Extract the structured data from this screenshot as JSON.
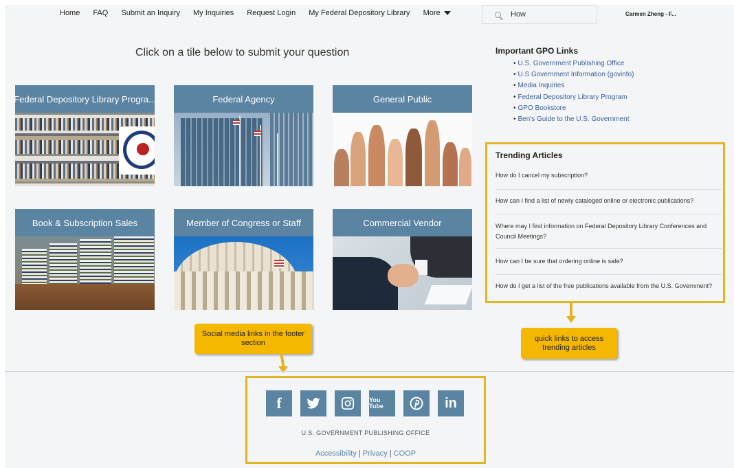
{
  "nav": {
    "items": [
      "Home",
      "FAQ",
      "Submit an Inquiry",
      "My Inquiries",
      "Request Login",
      "My Federal Depository Library"
    ],
    "more_label": "More"
  },
  "search": {
    "value": "How",
    "icon": "search-icon"
  },
  "user": {
    "name": "Carmen Zheng - F..."
  },
  "headline": "Click on a tile below to submit your question",
  "tiles": [
    {
      "label": "Federal Depository Library Progra..."
    },
    {
      "label": "Federal Agency"
    },
    {
      "label": "General Public"
    },
    {
      "label": "Book & Subscription Sales"
    },
    {
      "label": "Member of Congress or Staff"
    },
    {
      "label": "Commercial Vendor"
    }
  ],
  "gpo_links": {
    "title": "Important GPO Links",
    "items": [
      "U.S. Government Publishing Office",
      "U.S Government Information (govinfo)",
      "Media Inquiries",
      "Federal Depository Library Program",
      "GPO Bookstore",
      "Ben's Guide to the U.S. Government"
    ]
  },
  "trending": {
    "title": "Trending Articles",
    "articles": [
      "How do I cancel my subscription?",
      "How can I find a list of newly cataloged online or electronic publications?",
      "Where may I find information on Federal Depository Library Conferences and Council Meetings?",
      "How can I be sure that ordering online is safe?",
      "How do I get a list of the free publications available from the U.S. Government?"
    ]
  },
  "callouts": {
    "social": "Social media links in the footer section",
    "trending": "quick links to access trending articles"
  },
  "footer": {
    "social_icons": [
      "facebook-icon",
      "twitter-icon",
      "instagram-icon",
      "youtube-icon",
      "pinterest-icon",
      "linkedin-icon"
    ],
    "youtube_text": "You Tube",
    "linkedin_text": "in",
    "facebook_text": "f",
    "org": "U.S. GOVERNMENT PUBLISHING OFFICE",
    "links": [
      "Accessibility",
      "Privacy",
      "COOP"
    ]
  },
  "colors": {
    "accent": "#5b84a3",
    "highlight": "#e6b322",
    "callout": "#f5b800",
    "link": "#3a5f9c"
  }
}
